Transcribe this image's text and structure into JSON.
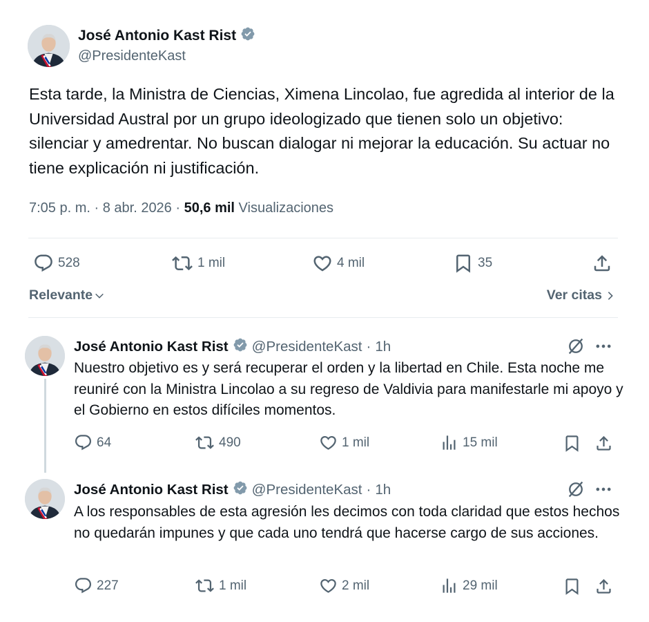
{
  "main_tweet": {
    "author_name": "José Antonio Kast Rist",
    "author_handle": "@PresidenteKast",
    "text": "Esta tarde, la Ministra de Ciencias, Ximena Lincolao, fue agredida al interior de la Universidad Austral por un grupo ideologizado que tienen solo un objetivo: silenciar y amedrentar. No buscan dialogar ni mejorar la educación. Su actuar no tiene explicación ni justificación.",
    "time": "7:05 p. m.",
    "date": "8 abr. 2026",
    "views_count": "50,6 mil",
    "views_label": "Visualizaciones",
    "replies": "528",
    "reposts": "1 mil",
    "likes": "4 mil",
    "bookmarks": "35"
  },
  "sort": {
    "label": "Relevante",
    "quotes_label": "Ver citas"
  },
  "replies": [
    {
      "author_name": "José Antonio Kast Rist",
      "author_handle": "@PresidenteKast",
      "time": "1h",
      "text": "Nuestro objetivo es y será recuperar el orden y la libertad en Chile. Esta noche me reuniré con la Ministra Lincolao a su regreso de Valdivia para manifestarle mi apoyo y el Gobierno en estos difíciles momentos.",
      "replies": "64",
      "reposts": "490",
      "likes": "1 mil",
      "views": "15 mil"
    },
    {
      "author_name": "José Antonio Kast Rist",
      "author_handle": "@PresidenteKast",
      "time": "1h",
      "text": "A los responsables de esta agresión les decimos con toda claridad que estos hechos no quedarán impunes y que cada uno tendrá que hacerse cargo de sus acciones.",
      "replies": "227",
      "reposts": "1 mil",
      "likes": "2 mil",
      "views": "29 mil"
    }
  ],
  "icons": [
    "verified-badge-icon",
    "reply-icon",
    "repost-icon",
    "like-icon",
    "bookmark-icon",
    "share-icon",
    "views-icon",
    "grok-icon",
    "more-icon",
    "chevron-down-icon",
    "chevron-right-icon"
  ],
  "colors": {
    "text": "#0f1419",
    "secondary": "#536471",
    "verified_badge": "#829aab",
    "divider": "#e8ecef"
  }
}
